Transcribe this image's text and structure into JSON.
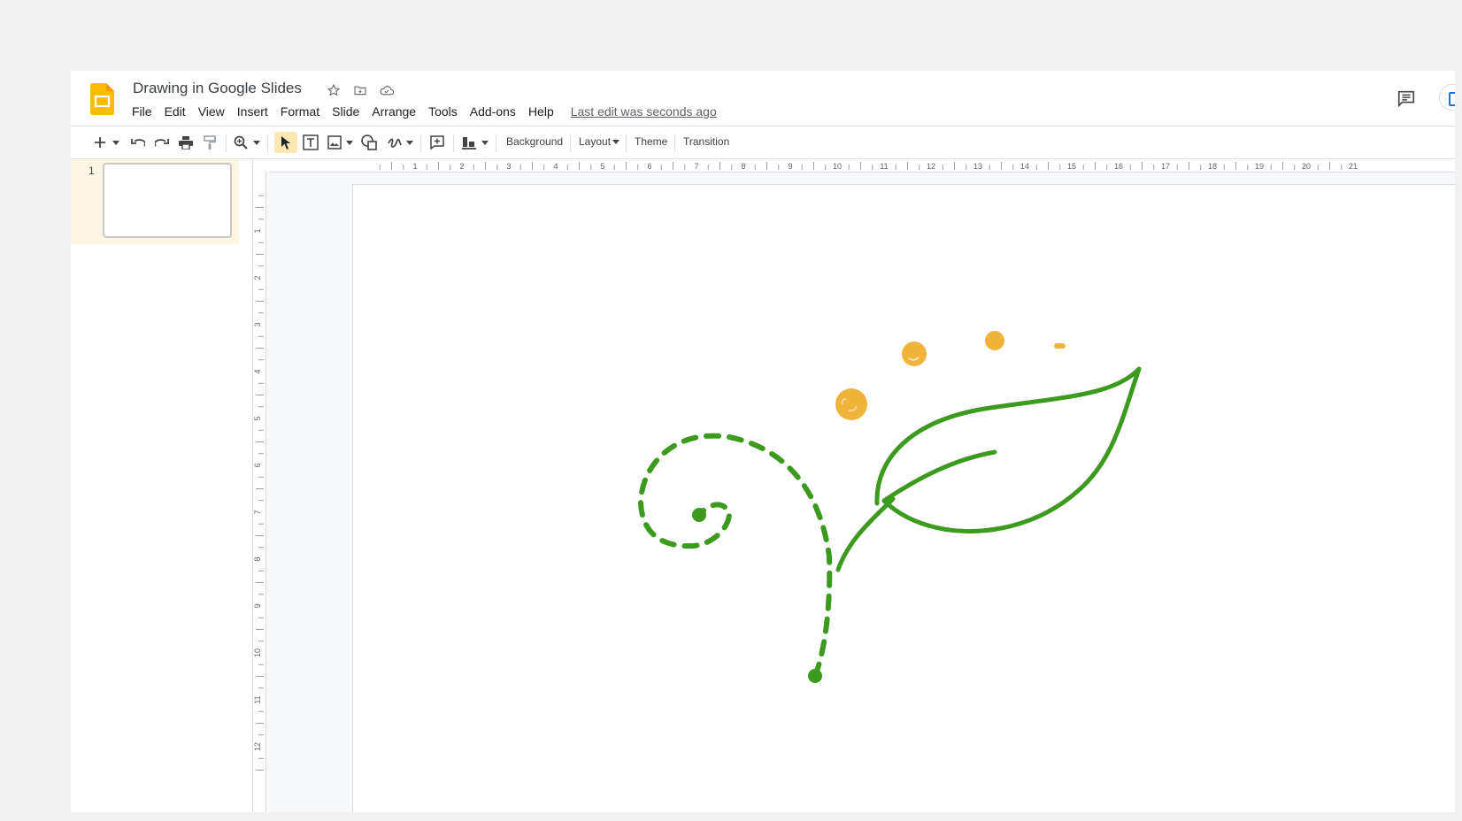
{
  "header": {
    "title": "Drawing in Google Slides",
    "last_edit": "Last edit was seconds ago",
    "menu": [
      "File",
      "Edit",
      "View",
      "Insert",
      "Format",
      "Slide",
      "Arrange",
      "Tools",
      "Add-ons",
      "Help"
    ]
  },
  "toolbar": {
    "background_label": "Background",
    "layout_label": "Layout",
    "theme_label": "Theme",
    "transition_label": "Transition",
    "icons": [
      "plus-icon",
      "undo-icon",
      "redo-icon",
      "print-icon",
      "paint-format-icon",
      "zoom-icon",
      "select-cursor-icon",
      "text-box-icon",
      "image-icon",
      "shape-icon",
      "scribble-icon",
      "comment-add-icon",
      "align-icon"
    ]
  },
  "filmstrip": {
    "slides": [
      {
        "number": "1"
      }
    ]
  },
  "rulers": {
    "horizontal": [
      "1",
      "2",
      "3",
      "4",
      "5",
      "6",
      "7",
      "8",
      "9",
      "10",
      "11",
      "12",
      "13",
      "14",
      "15",
      "16",
      "17",
      "18",
      "19",
      "20",
      "21"
    ],
    "vertical": [
      "1",
      "2",
      "3",
      "4",
      "5",
      "6",
      "7",
      "8",
      "9",
      "10",
      "11",
      "12"
    ]
  },
  "colors": {
    "accent": "#fbbc04",
    "stroke_green": "#3c9a1f",
    "dot_orange": "#f0b43a",
    "active_tool": "#fce8b2"
  }
}
